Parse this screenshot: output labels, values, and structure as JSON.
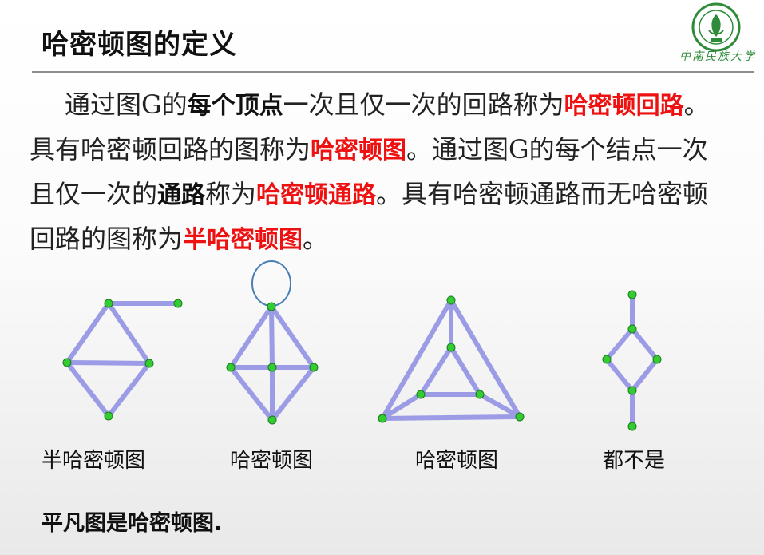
{
  "slide": {
    "title": "哈密顿图的定义",
    "logo_script": "中南民族大学",
    "paragraph": [
      {
        "text": "通过图G的",
        "style": "normal"
      },
      {
        "text": "每个顶点",
        "style": "bold"
      },
      {
        "text": "一次且仅一次的回路称为",
        "style": "normal"
      },
      {
        "text": "哈密顿回路",
        "style": "red"
      },
      {
        "text": "。具有哈密顿回路的图称为",
        "style": "normal"
      },
      {
        "text": "哈密顿图",
        "style": "red"
      },
      {
        "text": "。通过图G的每个结点一次且仅一次的",
        "style": "normal"
      },
      {
        "text": "通路",
        "style": "bold"
      },
      {
        "text": "称为",
        "style": "normal"
      },
      {
        "text": "哈密顿通路",
        "style": "red"
      },
      {
        "text": "。具有哈密顿通路而无哈密顿回路的图称为",
        "style": "normal"
      },
      {
        "text": "半哈密顿图",
        "style": "red"
      },
      {
        "text": "。",
        "style": "normal"
      }
    ],
    "captions": [
      "半哈密顿图",
      "哈密顿图",
      "哈密顿图",
      "都不是"
    ],
    "footer_note": "平凡图是哈密顿图.",
    "colors": {
      "edge": "#9b9be6",
      "node": "#33cc33",
      "loop": "#4a7fb5",
      "highlight": "#ee1111"
    }
  },
  "graphs": [
    {
      "caption_index": 0,
      "nodes": [
        "a",
        "b",
        "c",
        "d",
        "e"
      ],
      "edges": [
        [
          "a",
          "b"
        ],
        [
          "a",
          "e"
        ],
        [
          "a",
          "c"
        ],
        [
          "b",
          "c"
        ],
        [
          "b",
          "d"
        ],
        [
          "c",
          "d"
        ]
      ]
    },
    {
      "caption_index": 1,
      "nodes": [
        "top",
        "left",
        "center",
        "right",
        "bottom"
      ],
      "edges": [
        [
          "top",
          "left"
        ],
        [
          "top",
          "center"
        ],
        [
          "top",
          "right"
        ],
        [
          "left",
          "center"
        ],
        [
          "center",
          "right"
        ],
        [
          "left",
          "bottom"
        ],
        [
          "center",
          "bottom"
        ],
        [
          "right",
          "bottom"
        ]
      ],
      "loops": [
        "top"
      ]
    },
    {
      "caption_index": 2,
      "nodes": [
        "o1",
        "o2",
        "o3",
        "i1",
        "i2",
        "i3"
      ],
      "edges": [
        [
          "o1",
          "o2"
        ],
        [
          "o2",
          "o3"
        ],
        [
          "o3",
          "o1"
        ],
        [
          "i1",
          "i2"
        ],
        [
          "i2",
          "i3"
        ],
        [
          "i3",
          "i1"
        ],
        [
          "o1",
          "i1"
        ],
        [
          "o2",
          "i2"
        ],
        [
          "o3",
          "i3"
        ]
      ]
    },
    {
      "caption_index": 3,
      "nodes": [
        "t",
        "u",
        "l",
        "r",
        "m",
        "b"
      ],
      "edges": [
        [
          "t",
          "u"
        ],
        [
          "u",
          "l"
        ],
        [
          "u",
          "r"
        ],
        [
          "l",
          "m"
        ],
        [
          "r",
          "m"
        ],
        [
          "m",
          "b"
        ]
      ]
    }
  ]
}
